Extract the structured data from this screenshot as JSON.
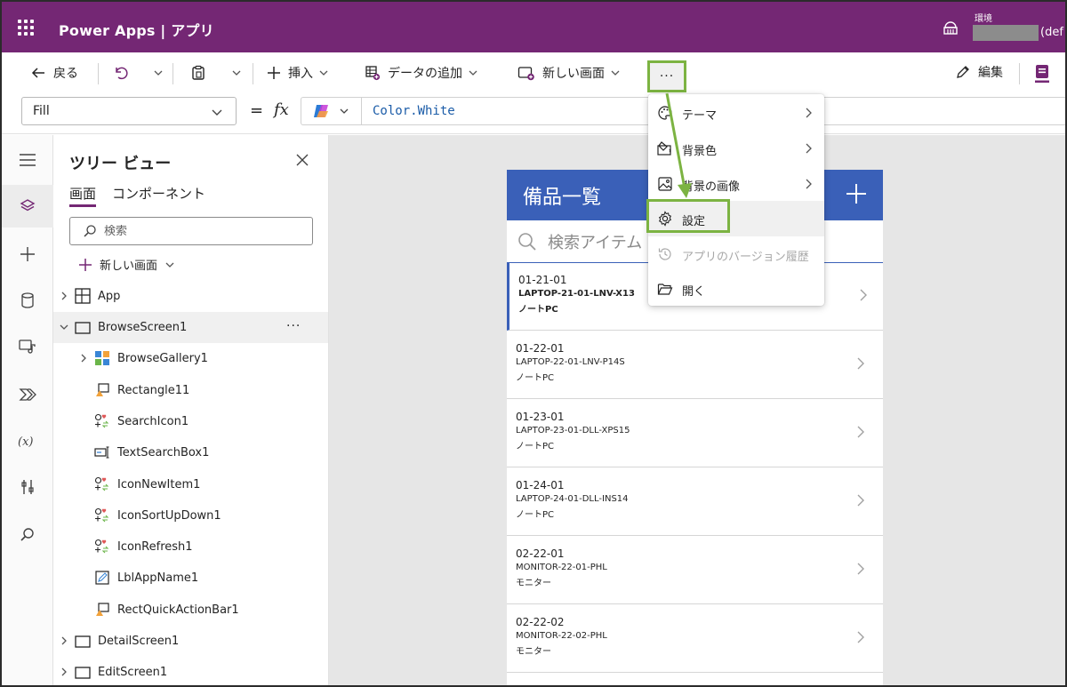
{
  "header": {
    "app_title": "Power Apps | アプリ",
    "env_label": "環境",
    "env_suffix": "(def"
  },
  "commandbar": {
    "back_label": "戻る",
    "insert_label": "挿入",
    "add_data_label": "データの追加",
    "new_screen_label": "新しい画面",
    "more_label": "···",
    "edit_label": "編集"
  },
  "formula": {
    "property": "Fill",
    "equals": "=",
    "fx": "fx",
    "value": "Color.White"
  },
  "tree": {
    "title": "ツリー ビュー",
    "tabs": [
      "画面",
      "コンポーネント"
    ],
    "search_placeholder": "検索",
    "new_screen_label": "新しい画面",
    "nodes": [
      "App",
      "BrowseScreen1",
      "BrowseGallery1",
      "Rectangle11",
      "SearchIcon1",
      "TextSearchBox1",
      "IconNewItem1",
      "IconSortUpDown1",
      "IconRefresh1",
      "LblAppName1",
      "RectQuickActionBar1",
      "DetailScreen1",
      "EditScreen1"
    ],
    "node_more": "···"
  },
  "phone": {
    "title": "備品一覧",
    "search_placeholder": "検索アイテム",
    "items": [
      {
        "code": "01-21-01",
        "name": "LAPTOP-21-01-LNV-X13",
        "category": "ノートPC"
      },
      {
        "code": "01-22-01",
        "name": "LAPTOP-22-01-LNV-P14S",
        "category": "ノートPC"
      },
      {
        "code": "01-23-01",
        "name": "LAPTOP-23-01-DLL-XPS15",
        "category": "ノートPC"
      },
      {
        "code": "01-24-01",
        "name": "LAPTOP-24-01-DLL-INS14",
        "category": "ノートPC"
      },
      {
        "code": "02-22-01",
        "name": "MONITOR-22-01-PHL",
        "category": "モニター"
      },
      {
        "code": "02-22-02",
        "name": "MONITOR-22-02-PHL",
        "category": "モニター"
      }
    ]
  },
  "menu": {
    "items": [
      {
        "label": "テーマ",
        "icon": "theme-icon"
      },
      {
        "label": "背景色",
        "icon": "background-color-icon"
      },
      {
        "label": "背景の画像",
        "icon": "background-image-icon"
      },
      {
        "label": "設定",
        "icon": "gear-icon"
      },
      {
        "label": "アプリのバージョン履歴",
        "icon": "history-icon"
      },
      {
        "label": "開く",
        "icon": "folder-open-icon"
      }
    ]
  },
  "colors": {
    "header_bg": "#742774",
    "accent_purple": "#742774",
    "phone_header": "#3a60b8",
    "highlight_green": "#7cb342",
    "canvas_bg": "#e6e6e6"
  }
}
